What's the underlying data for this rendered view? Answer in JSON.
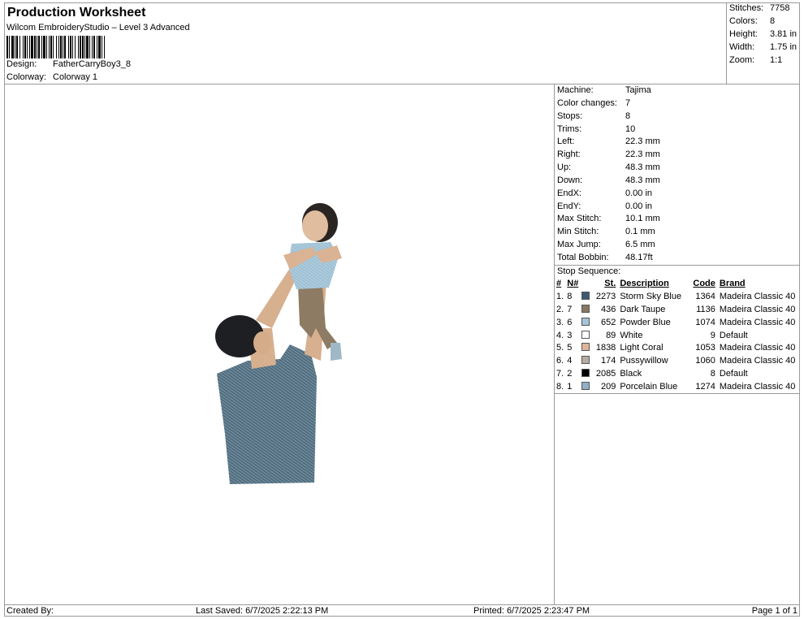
{
  "header": {
    "title": "Production Worksheet",
    "subtitle": "Wilcom EmbroideryStudio – Level 3 Advanced",
    "design_label": "Design:",
    "design_value": "FatherCarryBoy3_8",
    "colorway_label": "Colorway:",
    "colorway_value": "Colorway 1"
  },
  "summary": [
    {
      "label": "Stitches:",
      "value": "7758"
    },
    {
      "label": "Colors:",
      "value": "8"
    },
    {
      "label": "Height:",
      "value": "3.81 in"
    },
    {
      "label": "Width:",
      "value": "1.75 in"
    },
    {
      "label": "Zoom:",
      "value": "1:1"
    }
  ],
  "machine_info": [
    {
      "label": "Machine:",
      "value": "Tajima"
    },
    {
      "label": "Color changes:",
      "value": "7"
    },
    {
      "label": "Stops:",
      "value": "8"
    },
    {
      "label": "Trims:",
      "value": "10"
    },
    {
      "label": "Left:",
      "value": "22.3 mm"
    },
    {
      "label": "Right:",
      "value": "22.3 mm"
    },
    {
      "label": "Up:",
      "value": "48.3 mm"
    },
    {
      "label": "Down:",
      "value": "48.3 mm"
    },
    {
      "label": "EndX:",
      "value": "0.00 in"
    },
    {
      "label": "EndY:",
      "value": "0.00 in"
    },
    {
      "label": "Max Stitch:",
      "value": "10.1 mm"
    },
    {
      "label": "Min Stitch:",
      "value": "0.1 mm"
    },
    {
      "label": "Max Jump:",
      "value": "6.5 mm"
    },
    {
      "label": "Total Bobbin:",
      "value": "48.17ft"
    }
  ],
  "stop_sequence": {
    "title": "Stop Sequence:",
    "columns": {
      "num": "#",
      "n": "N#",
      "st": "St.",
      "desc": "Description",
      "code": "Code",
      "brand": "Brand"
    },
    "rows": [
      {
        "num": "1.",
        "n": "8",
        "color": "#3d5a73",
        "st": "2273",
        "desc": "Storm Sky Blue",
        "code": "1364",
        "brand": "Madeira Classic 40"
      },
      {
        "num": "2.",
        "n": "7",
        "color": "#8a7866",
        "st": "436",
        "desc": "Dark Taupe",
        "code": "1136",
        "brand": "Madeira Classic 40"
      },
      {
        "num": "3.",
        "n": "6",
        "color": "#a7c3d8",
        "st": "652",
        "desc": "Powder Blue",
        "code": "1074",
        "brand": "Madeira Classic 40"
      },
      {
        "num": "4.",
        "n": "3",
        "color": "#ffffff",
        "st": "89",
        "desc": "White",
        "code": "9",
        "brand": "Default"
      },
      {
        "num": "5.",
        "n": "5",
        "color": "#dcb498",
        "st": "1838",
        "desc": "Light Coral",
        "code": "1053",
        "brand": "Madeira Classic 40"
      },
      {
        "num": "6.",
        "n": "4",
        "color": "#b8ada2",
        "st": "174",
        "desc": "Pussywillow",
        "code": "1060",
        "brand": "Madeira Classic 40"
      },
      {
        "num": "7.",
        "n": "2",
        "color": "#000000",
        "st": "2085",
        "desc": "Black",
        "code": "8",
        "brand": "Default"
      },
      {
        "num": "8.",
        "n": "1",
        "color": "#8fb0c8",
        "st": "209",
        "desc": "Porcelain Blue",
        "code": "1274",
        "brand": "Madeira Classic 40"
      }
    ]
  },
  "footer": {
    "created_by": "Created By:",
    "last_saved": "Last Saved: 6/7/2025 2:22:13 PM",
    "printed": "Printed: 6/7/2025 2:23:47 PM",
    "page": "Page 1 of 1"
  }
}
